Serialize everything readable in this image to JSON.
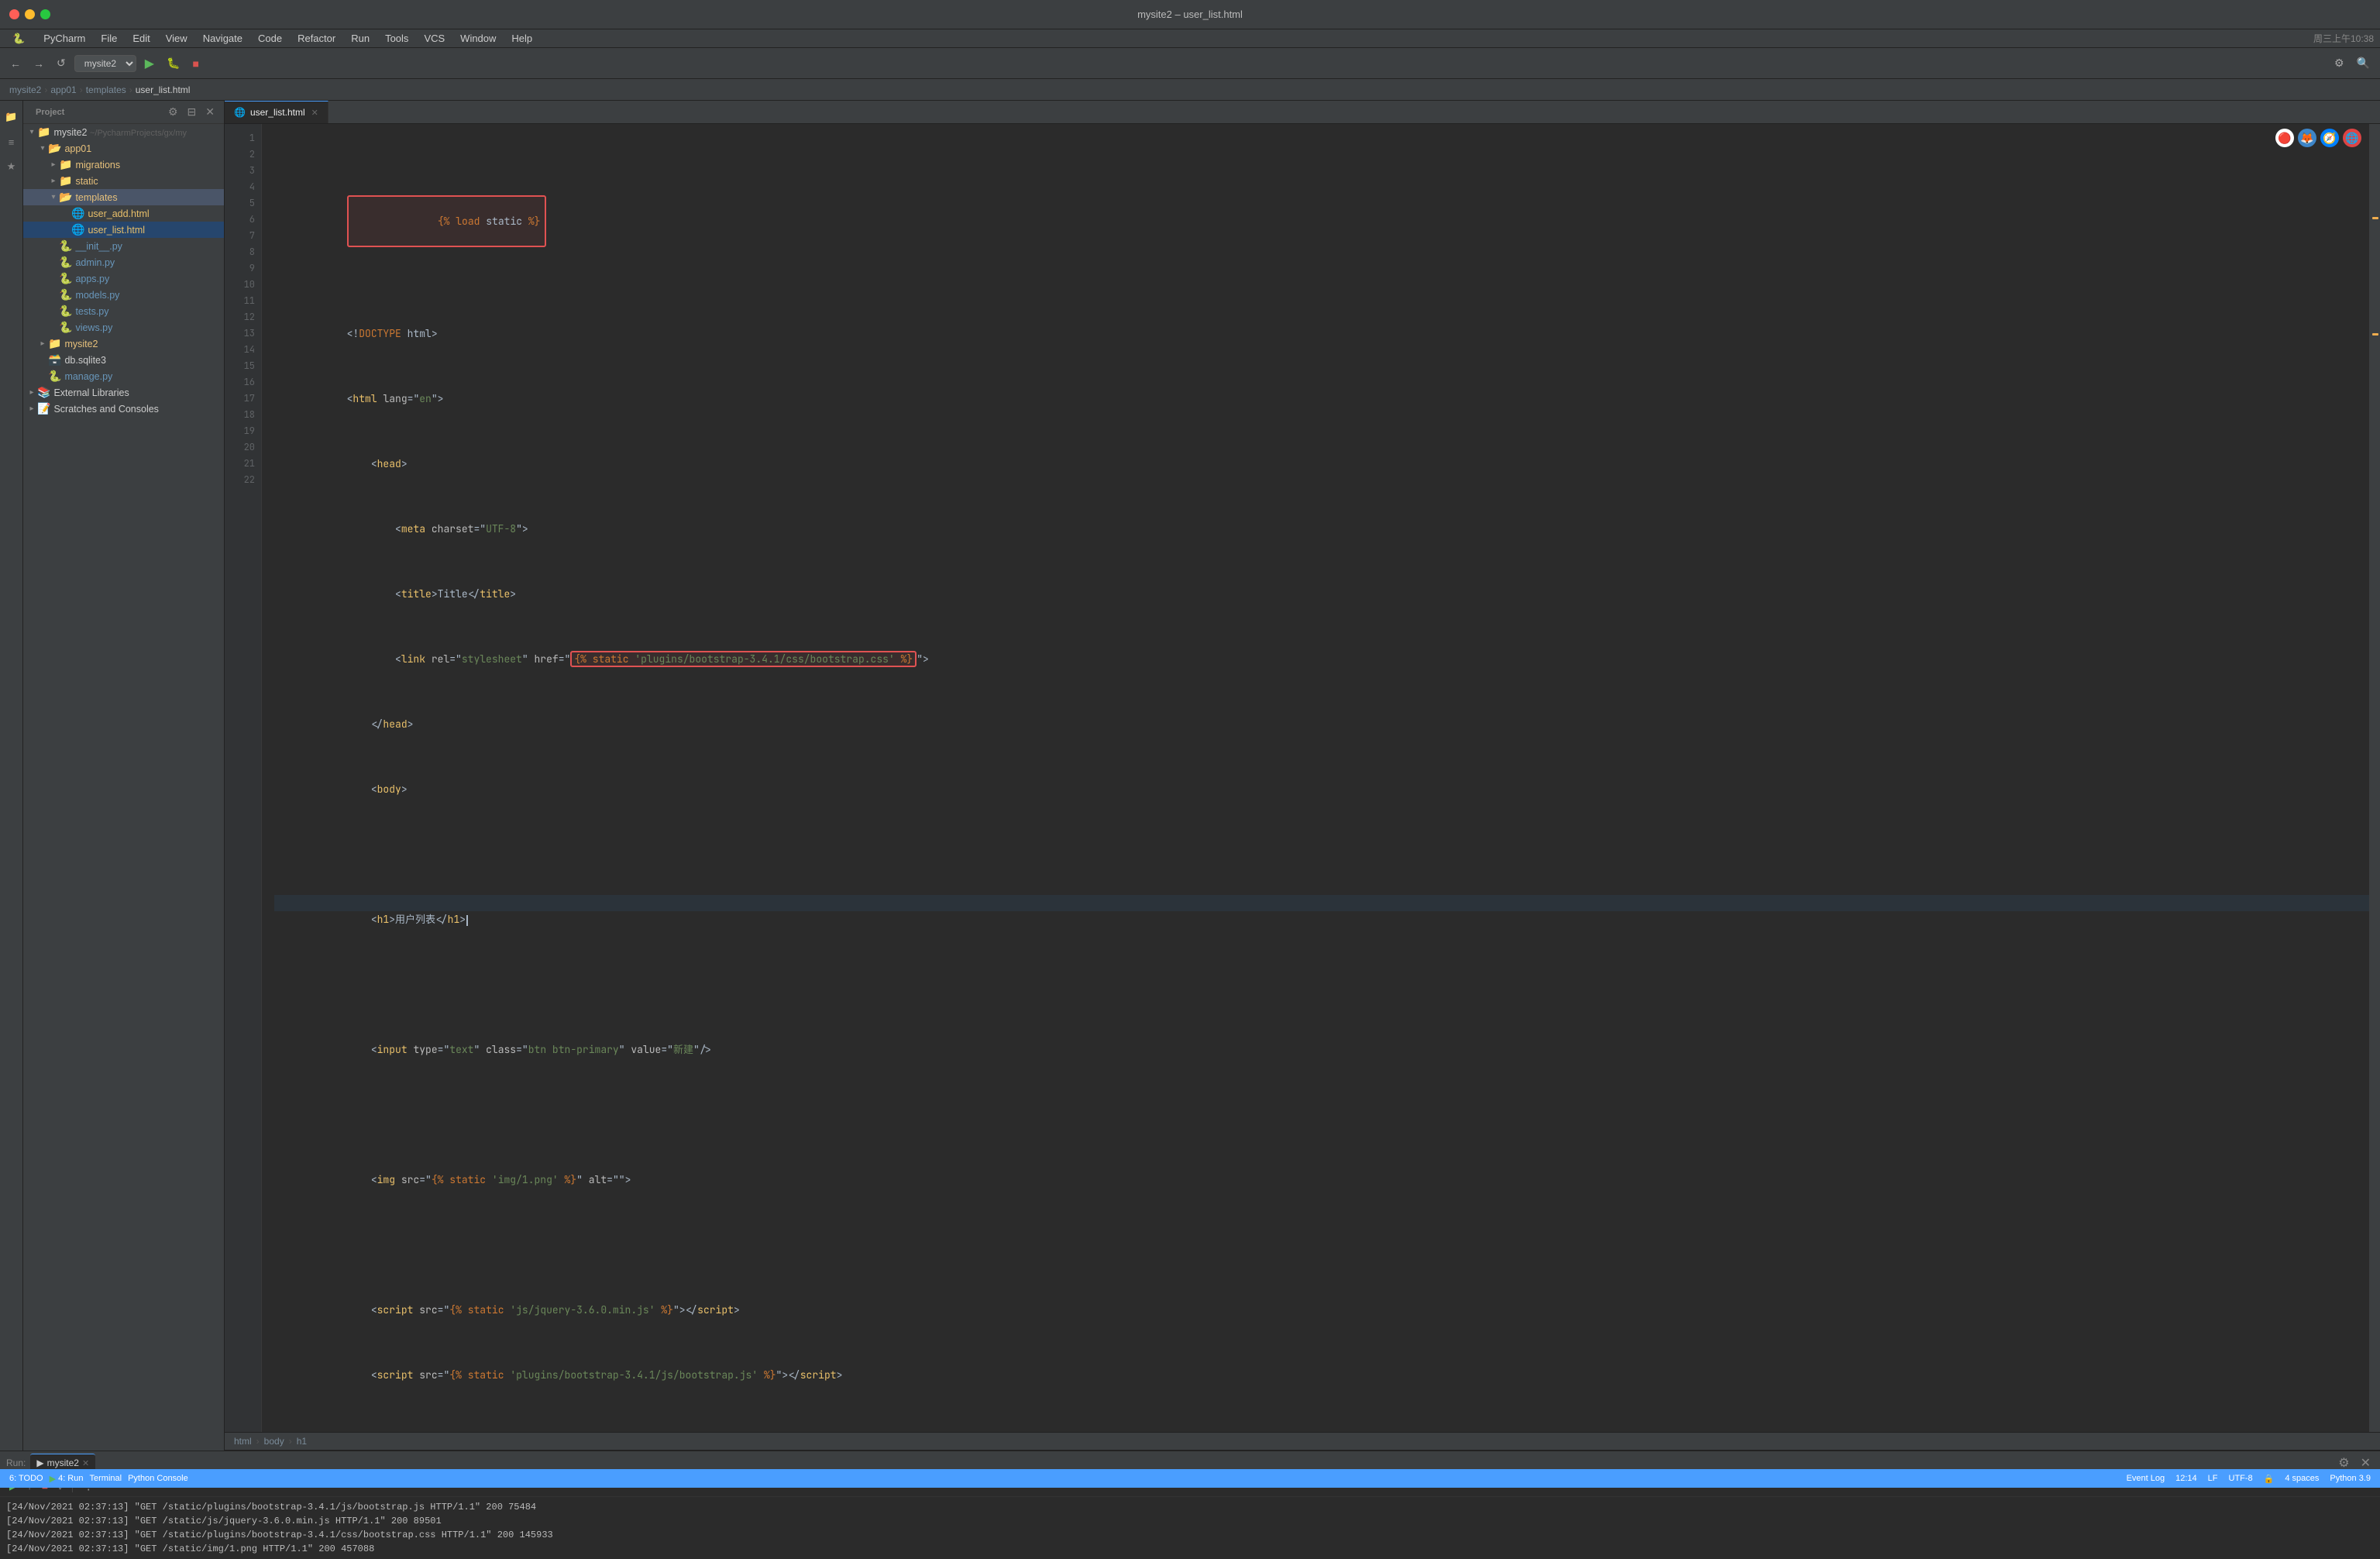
{
  "window": {
    "title": "mysite2 – user_list.html"
  },
  "menu": {
    "logo": "PyCharm",
    "items": [
      "File",
      "Edit",
      "View",
      "Navigate",
      "Code",
      "Refactor",
      "Run",
      "Tools",
      "VCS",
      "Window",
      "Help"
    ]
  },
  "toolbar": {
    "project_selector": "mysite2",
    "run_btn": "▶",
    "stop_btn": "■"
  },
  "breadcrumb": {
    "items": [
      "mysite2",
      "app01",
      "templates",
      "user_list.html"
    ]
  },
  "sidebar": {
    "title": "Project",
    "tree": [
      {
        "id": "mysite2-root",
        "label": "mysite2",
        "extra": "~/PycharmProjects/gx/my",
        "type": "root",
        "level": 0,
        "expanded": true,
        "arrow": "▾"
      },
      {
        "id": "app01",
        "label": "app01",
        "type": "folder",
        "level": 1,
        "expanded": true,
        "arrow": "▾"
      },
      {
        "id": "migrations",
        "label": "migrations",
        "type": "folder",
        "level": 2,
        "expanded": false,
        "arrow": "▸"
      },
      {
        "id": "static",
        "label": "static",
        "type": "folder",
        "level": 2,
        "expanded": false,
        "arrow": "▸"
      },
      {
        "id": "templates",
        "label": "templates",
        "type": "folder",
        "level": 2,
        "expanded": true,
        "arrow": "▾"
      },
      {
        "id": "user_add.html",
        "label": "user_add.html",
        "type": "html",
        "level": 3,
        "arrow": ""
      },
      {
        "id": "user_list.html",
        "label": "user_list.html",
        "type": "html",
        "level": 3,
        "arrow": "",
        "selected": true
      },
      {
        "id": "init_py",
        "label": "__init__.py",
        "type": "python",
        "level": 2,
        "arrow": ""
      },
      {
        "id": "admin.py",
        "label": "admin.py",
        "type": "python",
        "level": 2,
        "arrow": ""
      },
      {
        "id": "apps.py",
        "label": "apps.py",
        "type": "python",
        "level": 2,
        "arrow": ""
      },
      {
        "id": "models.py",
        "label": "models.py",
        "type": "python",
        "level": 2,
        "arrow": ""
      },
      {
        "id": "tests.py",
        "label": "tests.py",
        "type": "python",
        "level": 2,
        "arrow": ""
      },
      {
        "id": "views.py",
        "label": "views.py",
        "type": "python",
        "level": 2,
        "arrow": ""
      },
      {
        "id": "mysite2-pkg",
        "label": "mysite2",
        "type": "folder",
        "level": 1,
        "expanded": false,
        "arrow": "▸"
      },
      {
        "id": "db.sqlite3",
        "label": "db.sqlite3",
        "type": "file",
        "level": 1,
        "arrow": ""
      },
      {
        "id": "manage.py",
        "label": "manage.py",
        "type": "python",
        "level": 1,
        "arrow": ""
      },
      {
        "id": "external-libs",
        "label": "External Libraries",
        "type": "folder",
        "level": 0,
        "expanded": false,
        "arrow": "▸"
      },
      {
        "id": "scratches",
        "label": "Scratches and Consoles",
        "type": "folder",
        "level": 0,
        "expanded": false,
        "arrow": "▸"
      }
    ]
  },
  "editor": {
    "tab": "user_list.html",
    "lines": [
      {
        "num": 1,
        "content": "{% load static %}",
        "highlight": "load_static"
      },
      {
        "num": 2,
        "content": ""
      },
      {
        "num": 3,
        "content": "<!DOCTYPE html>"
      },
      {
        "num": 4,
        "content": "<html lang=\"en\">"
      },
      {
        "num": 5,
        "content": "    <head>"
      },
      {
        "num": 6,
        "content": "        <meta charset=\"UTF-8\">"
      },
      {
        "num": 7,
        "content": "        <title>Title</title>"
      },
      {
        "num": 8,
        "content": "        <link rel=\"stylesheet\" href=\"{% static 'plugins/bootstrap-3.4.1/css/bootstrap.css' %}\">",
        "highlight": "static_bootstrap_css"
      },
      {
        "num": 9,
        "content": "    </head>"
      },
      {
        "num": 10,
        "content": "    <body>"
      },
      {
        "num": 11,
        "content": ""
      },
      {
        "num": 12,
        "content": "    <h1>用户列表</h1>",
        "cursor": true
      },
      {
        "num": 13,
        "content": ""
      },
      {
        "num": 14,
        "content": "    <input type=\"text\" class=\"btn btn-primary\" value=\"新建\"/>"
      },
      {
        "num": 15,
        "content": ""
      },
      {
        "num": 16,
        "content": "    <img src=\"{% static 'img/1.png' %}\" alt=\"\">"
      },
      {
        "num": 17,
        "content": ""
      },
      {
        "num": 18,
        "content": "    <script src=\"{% static 'js/jquery-3.6.0.min.js' %}\"><\\/script>"
      },
      {
        "num": 19,
        "content": "    <script src=\"{% static 'plugins/bootstrap-3.4.1/js/bootstrap.js' %}\"><\\/script>"
      },
      {
        "num": 20,
        "content": "    </body>"
      },
      {
        "num": 21,
        "content": "    </html>"
      },
      {
        "num": 22,
        "content": ""
      }
    ]
  },
  "status_breadcrumb": {
    "items": [
      "html",
      "body",
      "h1"
    ]
  },
  "run_panel": {
    "tab": "mysite2",
    "log_lines": [
      "[24/Nov/2021 02:37:13] \"GET /static/plugins/bootstrap-3.4.1/js/bootstrap.js HTTP/1.1\" 200 75484",
      "[24/Nov/2021 02:37:13] \"GET /static/js/jquery-3.6.0.min.js HTTP/1.1\" 200 89501",
      "[24/Nov/2021 02:37:13] \"GET /static/plugins/bootstrap-3.4.1/css/bootstrap.css HTTP/1.1\" 200 145933",
      "[24/Nov/2021 02:37:13] \"GET /static/img/1.png HTTP/1.1\" 200 457088"
    ]
  },
  "status_bar": {
    "left": [
      "6: TODO",
      "4: Run",
      "Terminal",
      "Python Console"
    ],
    "right": {
      "line_col": "12:14",
      "line_ending": "LF",
      "encoding": "UTF-8",
      "indent": "4 spaces",
      "python": "Python 3.9",
      "event_log": "Event Log"
    }
  }
}
